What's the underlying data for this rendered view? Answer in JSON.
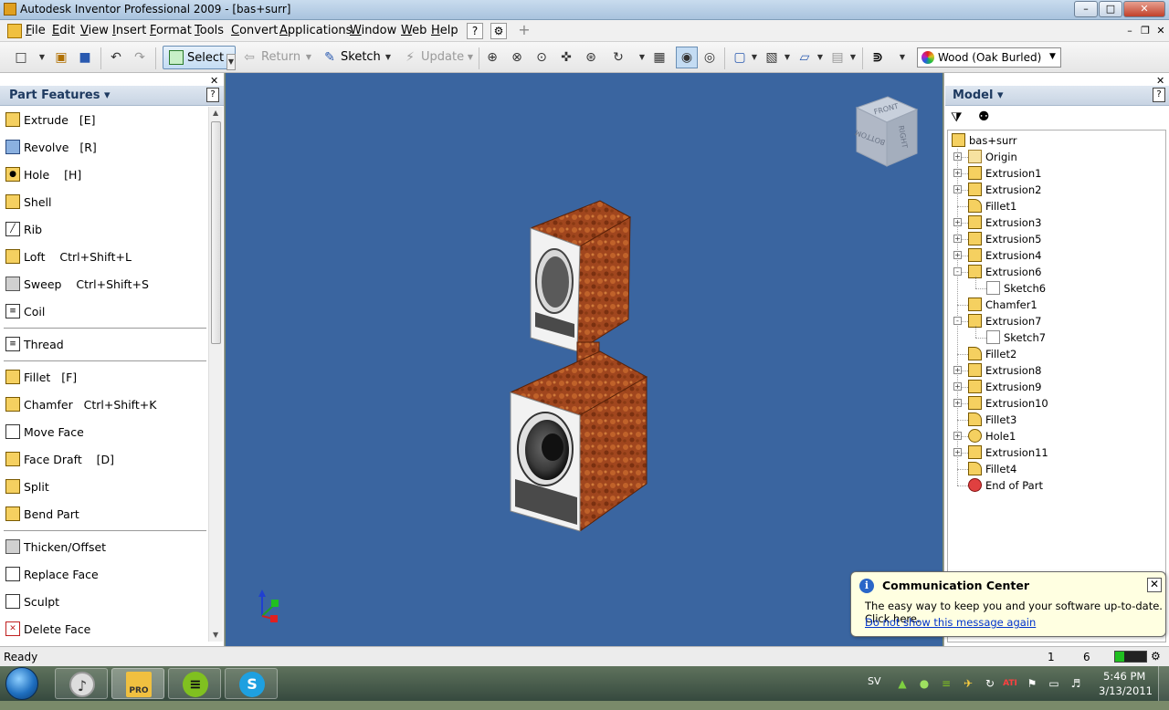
{
  "window": {
    "title": "Autodesk Inventor Professional 2009 - [bas+surr]"
  },
  "menu": [
    "File",
    "Edit",
    "View",
    "Insert",
    "Format",
    "Tools",
    "Convert",
    "Applications",
    "Window",
    "Web",
    "Help"
  ],
  "toolbar": {
    "select_label": "Select",
    "return_label": "Return",
    "sketch_label": "Sketch",
    "update_label": "Update",
    "material": "Wood (Oak Burled)"
  },
  "left_panel": {
    "title": "Part Features",
    "help": "?",
    "features": [
      {
        "label": "Extrude",
        "shortcut": "[E]"
      },
      {
        "label": "Revolve",
        "shortcut": "[R]"
      },
      {
        "label": "Hole",
        "shortcut": "[H]"
      },
      {
        "label": "Shell",
        "shortcut": ""
      },
      {
        "label": "Rib",
        "shortcut": ""
      },
      {
        "label": "Loft",
        "shortcut": "Ctrl+Shift+L"
      },
      {
        "label": "Sweep",
        "shortcut": "Ctrl+Shift+S"
      },
      {
        "label": "Coil",
        "shortcut": ""
      },
      {
        "label": "Thread",
        "shortcut": ""
      },
      {
        "label": "Fillet",
        "shortcut": "[F]"
      },
      {
        "label": "Chamfer",
        "shortcut": "Ctrl+Shift+K"
      },
      {
        "label": "Move Face",
        "shortcut": ""
      },
      {
        "label": "Face Draft",
        "shortcut": "[D]"
      },
      {
        "label": "Split",
        "shortcut": ""
      },
      {
        "label": "Bend Part",
        "shortcut": ""
      },
      {
        "label": "Thicken/Offset",
        "shortcut": ""
      },
      {
        "label": "Replace Face",
        "shortcut": ""
      },
      {
        "label": "Sculpt",
        "shortcut": ""
      },
      {
        "label": "Delete Face",
        "shortcut": ""
      }
    ]
  },
  "viewcube": {
    "top": "FRONT",
    "left": "BOTTOM",
    "right": "RIGHT"
  },
  "right_panel": {
    "title": "Model",
    "help": "?",
    "tree": [
      {
        "label": "bas+surr",
        "icon": "part-icon",
        "level": 0,
        "expander": ""
      },
      {
        "label": "Origin",
        "icon": "folder-icon",
        "level": 1,
        "expander": "+"
      },
      {
        "label": "Extrusion1",
        "icon": "extrude-icon",
        "level": 1,
        "expander": "+"
      },
      {
        "label": "Extrusion2",
        "icon": "extrude-icon",
        "level": 1,
        "expander": "+"
      },
      {
        "label": "Fillet1",
        "icon": "fillet-icon",
        "level": 1,
        "expander": ""
      },
      {
        "label": "Extrusion3",
        "icon": "extrude-icon",
        "level": 1,
        "expander": "+"
      },
      {
        "label": "Extrusion5",
        "icon": "extrude-icon",
        "level": 1,
        "expander": "+"
      },
      {
        "label": "Extrusion4",
        "icon": "extrude-icon",
        "level": 1,
        "expander": "+"
      },
      {
        "label": "Extrusion6",
        "icon": "extrude-icon",
        "level": 1,
        "expander": "-"
      },
      {
        "label": "Sketch6",
        "icon": "sketch-icon",
        "level": 2,
        "expander": ""
      },
      {
        "label": "Chamfer1",
        "icon": "chamfer-icon",
        "level": 1,
        "expander": ""
      },
      {
        "label": "Extrusion7",
        "icon": "extrude-icon",
        "level": 1,
        "expander": "-"
      },
      {
        "label": "Sketch7",
        "icon": "sketch-icon",
        "level": 2,
        "expander": ""
      },
      {
        "label": "Fillet2",
        "icon": "fillet-icon",
        "level": 1,
        "expander": ""
      },
      {
        "label": "Extrusion8",
        "icon": "extrude-icon",
        "level": 1,
        "expander": "+"
      },
      {
        "label": "Extrusion9",
        "icon": "extrude-icon",
        "level": 1,
        "expander": "+"
      },
      {
        "label": "Extrusion10",
        "icon": "extrude-icon",
        "level": 1,
        "expander": "+"
      },
      {
        "label": "Fillet3",
        "icon": "fillet-icon",
        "level": 1,
        "expander": ""
      },
      {
        "label": "Hole1",
        "icon": "hole-icon",
        "level": 1,
        "expander": "+"
      },
      {
        "label": "Extrusion11",
        "icon": "extrude-icon",
        "level": 1,
        "expander": "+"
      },
      {
        "label": "Fillet4",
        "icon": "fillet-icon",
        "level": 1,
        "expander": ""
      },
      {
        "label": "End of Part",
        "icon": "end-of-part-icon",
        "level": 1,
        "expander": ""
      }
    ]
  },
  "comm_center": {
    "title": "Communication Center",
    "message": "The easy way to keep you and your software up-to-date.  Click here.",
    "link": "Do not show this message again"
  },
  "status": {
    "text": "Ready",
    "n1": "1",
    "n2": "6"
  },
  "taskbar": {
    "lang": "SV",
    "time": "5:46 PM",
    "date": "3/13/2011",
    "pro_badge": "PRO"
  },
  "colors": {
    "viewport": "#3a65a0",
    "wood": "#a0461e",
    "accent": "#2a66c8"
  }
}
